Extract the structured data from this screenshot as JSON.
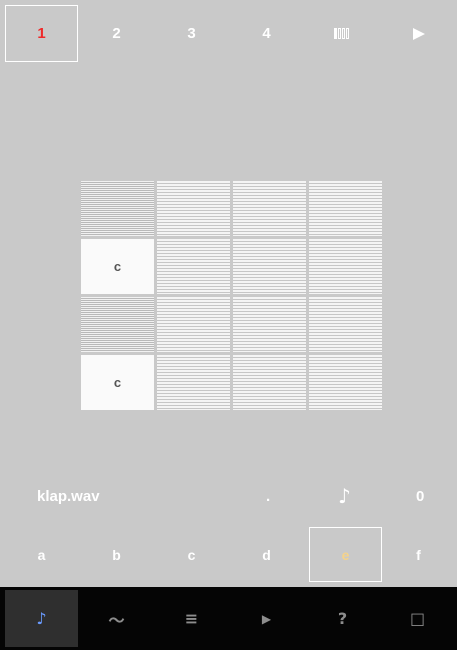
{
  "pattern_tabs": [
    {
      "label": "1",
      "selected": true
    },
    {
      "label": "2",
      "selected": false
    },
    {
      "label": "3",
      "selected": false
    },
    {
      "label": "4",
      "selected": false
    }
  ],
  "pattern_length_icon": "bars-icon",
  "play_icon": "play-icon",
  "grid": {
    "rows": [
      [
        "",
        "",
        "",
        ""
      ],
      [
        "c",
        "",
        "",
        ""
      ],
      [
        "",
        "",
        "",
        ""
      ],
      [
        "c",
        "",
        "",
        ""
      ]
    ]
  },
  "sample": {
    "name": "klap.wav",
    "dot": ".",
    "note_icon": "music-note-icon",
    "note_glyph": "♪",
    "value": "0"
  },
  "letters": [
    {
      "label": "a",
      "selected": false
    },
    {
      "label": "b",
      "selected": false
    },
    {
      "label": "c",
      "selected": false
    },
    {
      "label": "d",
      "selected": false
    },
    {
      "label": "e",
      "selected": true
    },
    {
      "label": "f",
      "selected": false
    }
  ],
  "toolbar": {
    "items": [
      {
        "icon": "music-note-icon",
        "glyph": "♪",
        "selected": true
      },
      {
        "icon": "wave-icon",
        "glyph": "〜",
        "selected": false
      },
      {
        "icon": "menu-icon",
        "glyph": "≡",
        "selected": false
      },
      {
        "icon": "play-icon",
        "glyph": "▶",
        "selected": false
      },
      {
        "icon": "question-icon",
        "glyph": "?",
        "selected": false
      },
      {
        "icon": "window-icon",
        "glyph": "□",
        "selected": false
      }
    ]
  },
  "colors": {
    "background": "#c9c9c9",
    "selected_tab_text": "#ef2a2a",
    "selected_letter_text": "#f5d38a",
    "toolbar_background": "#050505",
    "toolbar_selected_icon": "#6a9bff"
  }
}
